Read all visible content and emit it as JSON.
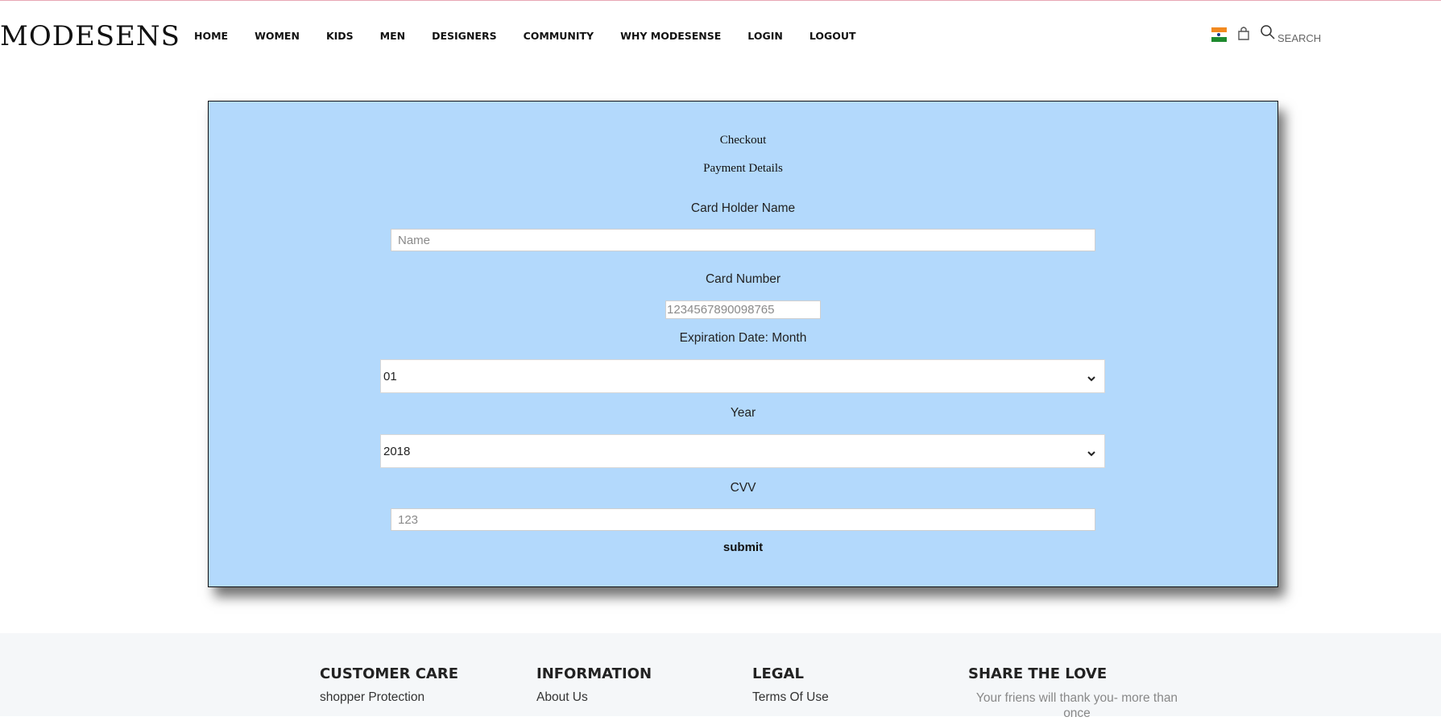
{
  "brand": {
    "logo": "MODESENS"
  },
  "nav": {
    "items": [
      "HOME",
      "WOMEN",
      "KIDS",
      "MEN",
      "DESIGNERS",
      "COMMUNITY",
      "WHY MODESENSE",
      "LOGIN",
      "LOGOUT"
    ]
  },
  "header": {
    "flag_icon": "india-flag-icon",
    "bag_icon": "shopping-bag-icon",
    "search_icon": "search-icon",
    "search_label": "SEARCH"
  },
  "checkout": {
    "title": "Checkout",
    "subtitle": "Payment Details",
    "card_holder_label": "Card Holder Name",
    "card_holder_placeholder": "Name",
    "card_number_label": "Card Number",
    "card_number_placeholder": "1234567890098765",
    "exp_month_label": "Expiration Date: Month",
    "exp_month_value": "01",
    "year_label": "Year",
    "year_value": "2018",
    "cvv_label": "CVV",
    "cvv_placeholder": "123",
    "submit_label": "submit",
    "background_color": "#b3d9fc"
  },
  "footer": {
    "customer_care": {
      "heading": "CUSTOMER CARE",
      "link": "shopper Protection"
    },
    "information": {
      "heading": "INFORMATION",
      "link": "About Us"
    },
    "legal": {
      "heading": "LEGAL",
      "link": "Terms Of Use"
    },
    "share": {
      "heading": "SHARE THE LOVE",
      "text": "Your friens will thank you- more than once"
    }
  }
}
